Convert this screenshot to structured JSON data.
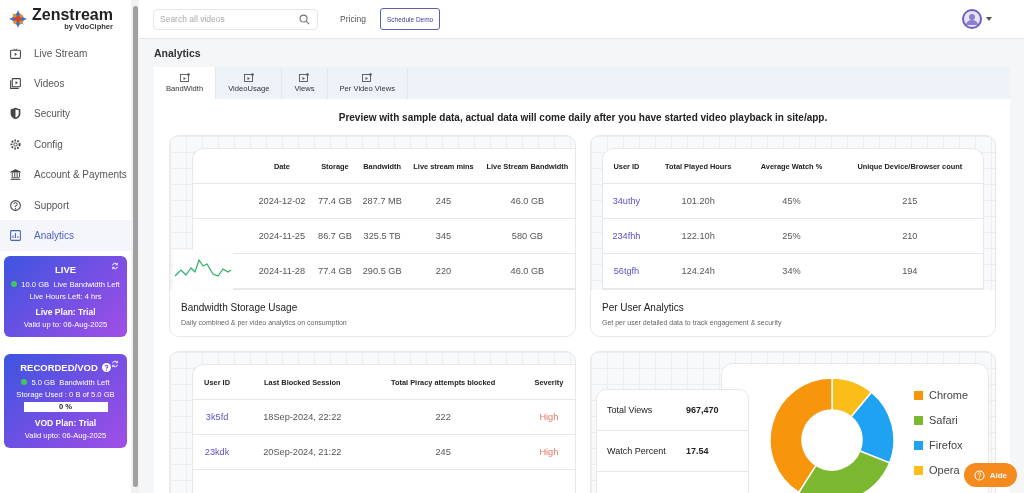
{
  "logo": {
    "name": "Zenstream",
    "sub": "by VdoCipher"
  },
  "nav": [
    {
      "label": "Live Stream",
      "selected": false
    },
    {
      "label": "Videos",
      "selected": false
    },
    {
      "label": "Security",
      "selected": false
    },
    {
      "label": "Config",
      "selected": false
    },
    {
      "label": "Account & Payments",
      "selected": false
    },
    {
      "label": "Support",
      "selected": false
    },
    {
      "label": "Analytics",
      "selected": true
    }
  ],
  "live_card": {
    "title": "LIVE",
    "bandwidth": "10.0 GB",
    "bandwidth_label": "Live Bandwidth Left",
    "hours": "Live Hours Left: 4 hrs",
    "plan": "Live Plan: Trial",
    "valid": "Valid up to: 06-Aug-2025"
  },
  "vod_card": {
    "title": "RECORDED/VOD",
    "bandwidth": "5.0 GB",
    "bandwidth_label": "Bandwidth Left",
    "storage": "Storage Used : 0 B of 5.0 GB",
    "progress_text": "0 %",
    "level": 0,
    "plan": "VOD Plan: Trial",
    "valid": "Valid upto: 06-Aug-2025"
  },
  "topbar": {
    "search_placeholder": "Search all videos",
    "pricing": "Pricing",
    "schedule_demo": "Schedule Demo"
  },
  "page_title": "Analytics",
  "tabs": [
    {
      "label": "BandWidth",
      "selected": true
    },
    {
      "label": "VideoUsage",
      "selected": false
    },
    {
      "label": "Views",
      "selected": false
    },
    {
      "label": "Per Video Views",
      "selected": false
    }
  ],
  "notice": "Preview with sample data, actual data will come daily after you have started video playback in site/app.",
  "bandwidth_card": {
    "columns": [
      "Date",
      "Storage",
      "Bandwidth",
      "Live stream mins",
      "Live Stream Bandwidth"
    ],
    "rows": [
      [
        "2024-12-02",
        "77.4 GB",
        "287.7 MB",
        "245",
        "46.0 GB"
      ],
      [
        "2024-11-25",
        "86.7 GB",
        "325.5 TB",
        "345",
        "580 GB"
      ],
      [
        "2024-11-28",
        "77.4 GB",
        "290.5 GB",
        "220",
        "46.0 GB"
      ]
    ],
    "title": "Bandwidth Storage Usage",
    "description": "Daily combined & per video analytics on consumption"
  },
  "user_card": {
    "columns": [
      "User ID",
      "Total Played Hours",
      "Average Watch %",
      "Unique Device/Browser count"
    ],
    "rows": [
      [
        "34uthy",
        "101.20h",
        "45%",
        "215"
      ],
      [
        "234fhh",
        "122.10h",
        "25%",
        "210"
      ],
      [
        "56tgfh",
        "124.24h",
        "34%",
        "194"
      ]
    ],
    "title": "Per User Analytics",
    "description": "Get per user detailed data to track engagement & security"
  },
  "piracy_card": {
    "columns": [
      "User ID",
      "Last Blocked Session",
      "Total Piracy attempts blocked",
      "Severity"
    ],
    "rows": [
      [
        "3k5fd",
        "18Sep-2024, 22:22",
        "222",
        "High"
      ],
      [
        "23kdk",
        "20Sep-2024, 21:22",
        "245",
        "High"
      ]
    ]
  },
  "views_card": {
    "stats": [
      {
        "label": "Total Views",
        "value": "967,470"
      },
      {
        "label": "Watch Percent",
        "value": "17.54"
      }
    ],
    "legend": [
      {
        "label": "Chrome",
        "color": "#f7950c"
      },
      {
        "label": "Safari",
        "color": "#7cb82f"
      },
      {
        "label": "Firefox",
        "color": "#1fa2f2"
      },
      {
        "label": "Opera",
        "color": "#fbbd18"
      }
    ]
  },
  "help_button": "Aide"
}
